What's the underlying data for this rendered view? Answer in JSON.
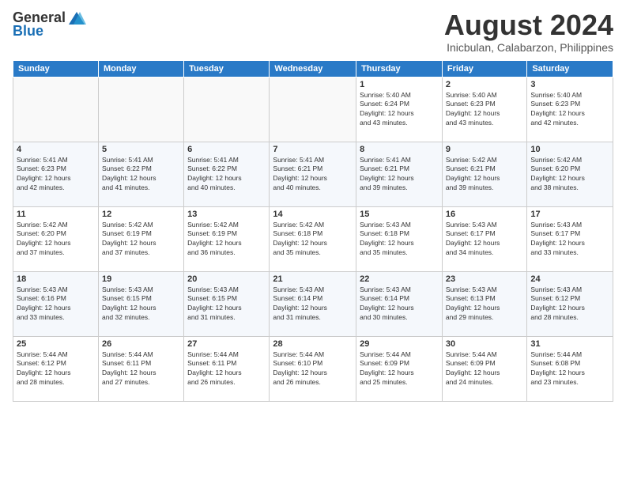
{
  "logo": {
    "general": "General",
    "blue": "Blue"
  },
  "title": "August 2024",
  "location": "Inicbulan, Calabarzon, Philippines",
  "headers": [
    "Sunday",
    "Monday",
    "Tuesday",
    "Wednesday",
    "Thursday",
    "Friday",
    "Saturday"
  ],
  "weeks": [
    [
      {
        "day": "",
        "info": ""
      },
      {
        "day": "",
        "info": ""
      },
      {
        "day": "",
        "info": ""
      },
      {
        "day": "",
        "info": ""
      },
      {
        "day": "1",
        "info": "Sunrise: 5:40 AM\nSunset: 6:24 PM\nDaylight: 12 hours\nand 43 minutes."
      },
      {
        "day": "2",
        "info": "Sunrise: 5:40 AM\nSunset: 6:23 PM\nDaylight: 12 hours\nand 43 minutes."
      },
      {
        "day": "3",
        "info": "Sunrise: 5:40 AM\nSunset: 6:23 PM\nDaylight: 12 hours\nand 42 minutes."
      }
    ],
    [
      {
        "day": "4",
        "info": "Sunrise: 5:41 AM\nSunset: 6:23 PM\nDaylight: 12 hours\nand 42 minutes."
      },
      {
        "day": "5",
        "info": "Sunrise: 5:41 AM\nSunset: 6:22 PM\nDaylight: 12 hours\nand 41 minutes."
      },
      {
        "day": "6",
        "info": "Sunrise: 5:41 AM\nSunset: 6:22 PM\nDaylight: 12 hours\nand 40 minutes."
      },
      {
        "day": "7",
        "info": "Sunrise: 5:41 AM\nSunset: 6:21 PM\nDaylight: 12 hours\nand 40 minutes."
      },
      {
        "day": "8",
        "info": "Sunrise: 5:41 AM\nSunset: 6:21 PM\nDaylight: 12 hours\nand 39 minutes."
      },
      {
        "day": "9",
        "info": "Sunrise: 5:42 AM\nSunset: 6:21 PM\nDaylight: 12 hours\nand 39 minutes."
      },
      {
        "day": "10",
        "info": "Sunrise: 5:42 AM\nSunset: 6:20 PM\nDaylight: 12 hours\nand 38 minutes."
      }
    ],
    [
      {
        "day": "11",
        "info": "Sunrise: 5:42 AM\nSunset: 6:20 PM\nDaylight: 12 hours\nand 37 minutes."
      },
      {
        "day": "12",
        "info": "Sunrise: 5:42 AM\nSunset: 6:19 PM\nDaylight: 12 hours\nand 37 minutes."
      },
      {
        "day": "13",
        "info": "Sunrise: 5:42 AM\nSunset: 6:19 PM\nDaylight: 12 hours\nand 36 minutes."
      },
      {
        "day": "14",
        "info": "Sunrise: 5:42 AM\nSunset: 6:18 PM\nDaylight: 12 hours\nand 35 minutes."
      },
      {
        "day": "15",
        "info": "Sunrise: 5:43 AM\nSunset: 6:18 PM\nDaylight: 12 hours\nand 35 minutes."
      },
      {
        "day": "16",
        "info": "Sunrise: 5:43 AM\nSunset: 6:17 PM\nDaylight: 12 hours\nand 34 minutes."
      },
      {
        "day": "17",
        "info": "Sunrise: 5:43 AM\nSunset: 6:17 PM\nDaylight: 12 hours\nand 33 minutes."
      }
    ],
    [
      {
        "day": "18",
        "info": "Sunrise: 5:43 AM\nSunset: 6:16 PM\nDaylight: 12 hours\nand 33 minutes."
      },
      {
        "day": "19",
        "info": "Sunrise: 5:43 AM\nSunset: 6:15 PM\nDaylight: 12 hours\nand 32 minutes."
      },
      {
        "day": "20",
        "info": "Sunrise: 5:43 AM\nSunset: 6:15 PM\nDaylight: 12 hours\nand 31 minutes."
      },
      {
        "day": "21",
        "info": "Sunrise: 5:43 AM\nSunset: 6:14 PM\nDaylight: 12 hours\nand 31 minutes."
      },
      {
        "day": "22",
        "info": "Sunrise: 5:43 AM\nSunset: 6:14 PM\nDaylight: 12 hours\nand 30 minutes."
      },
      {
        "day": "23",
        "info": "Sunrise: 5:43 AM\nSunset: 6:13 PM\nDaylight: 12 hours\nand 29 minutes."
      },
      {
        "day": "24",
        "info": "Sunrise: 5:43 AM\nSunset: 6:12 PM\nDaylight: 12 hours\nand 28 minutes."
      }
    ],
    [
      {
        "day": "25",
        "info": "Sunrise: 5:44 AM\nSunset: 6:12 PM\nDaylight: 12 hours\nand 28 minutes."
      },
      {
        "day": "26",
        "info": "Sunrise: 5:44 AM\nSunset: 6:11 PM\nDaylight: 12 hours\nand 27 minutes."
      },
      {
        "day": "27",
        "info": "Sunrise: 5:44 AM\nSunset: 6:11 PM\nDaylight: 12 hours\nand 26 minutes."
      },
      {
        "day": "28",
        "info": "Sunrise: 5:44 AM\nSunset: 6:10 PM\nDaylight: 12 hours\nand 26 minutes."
      },
      {
        "day": "29",
        "info": "Sunrise: 5:44 AM\nSunset: 6:09 PM\nDaylight: 12 hours\nand 25 minutes."
      },
      {
        "day": "30",
        "info": "Sunrise: 5:44 AM\nSunset: 6:09 PM\nDaylight: 12 hours\nand 24 minutes."
      },
      {
        "day": "31",
        "info": "Sunrise: 5:44 AM\nSunset: 6:08 PM\nDaylight: 12 hours\nand 23 minutes."
      }
    ]
  ]
}
